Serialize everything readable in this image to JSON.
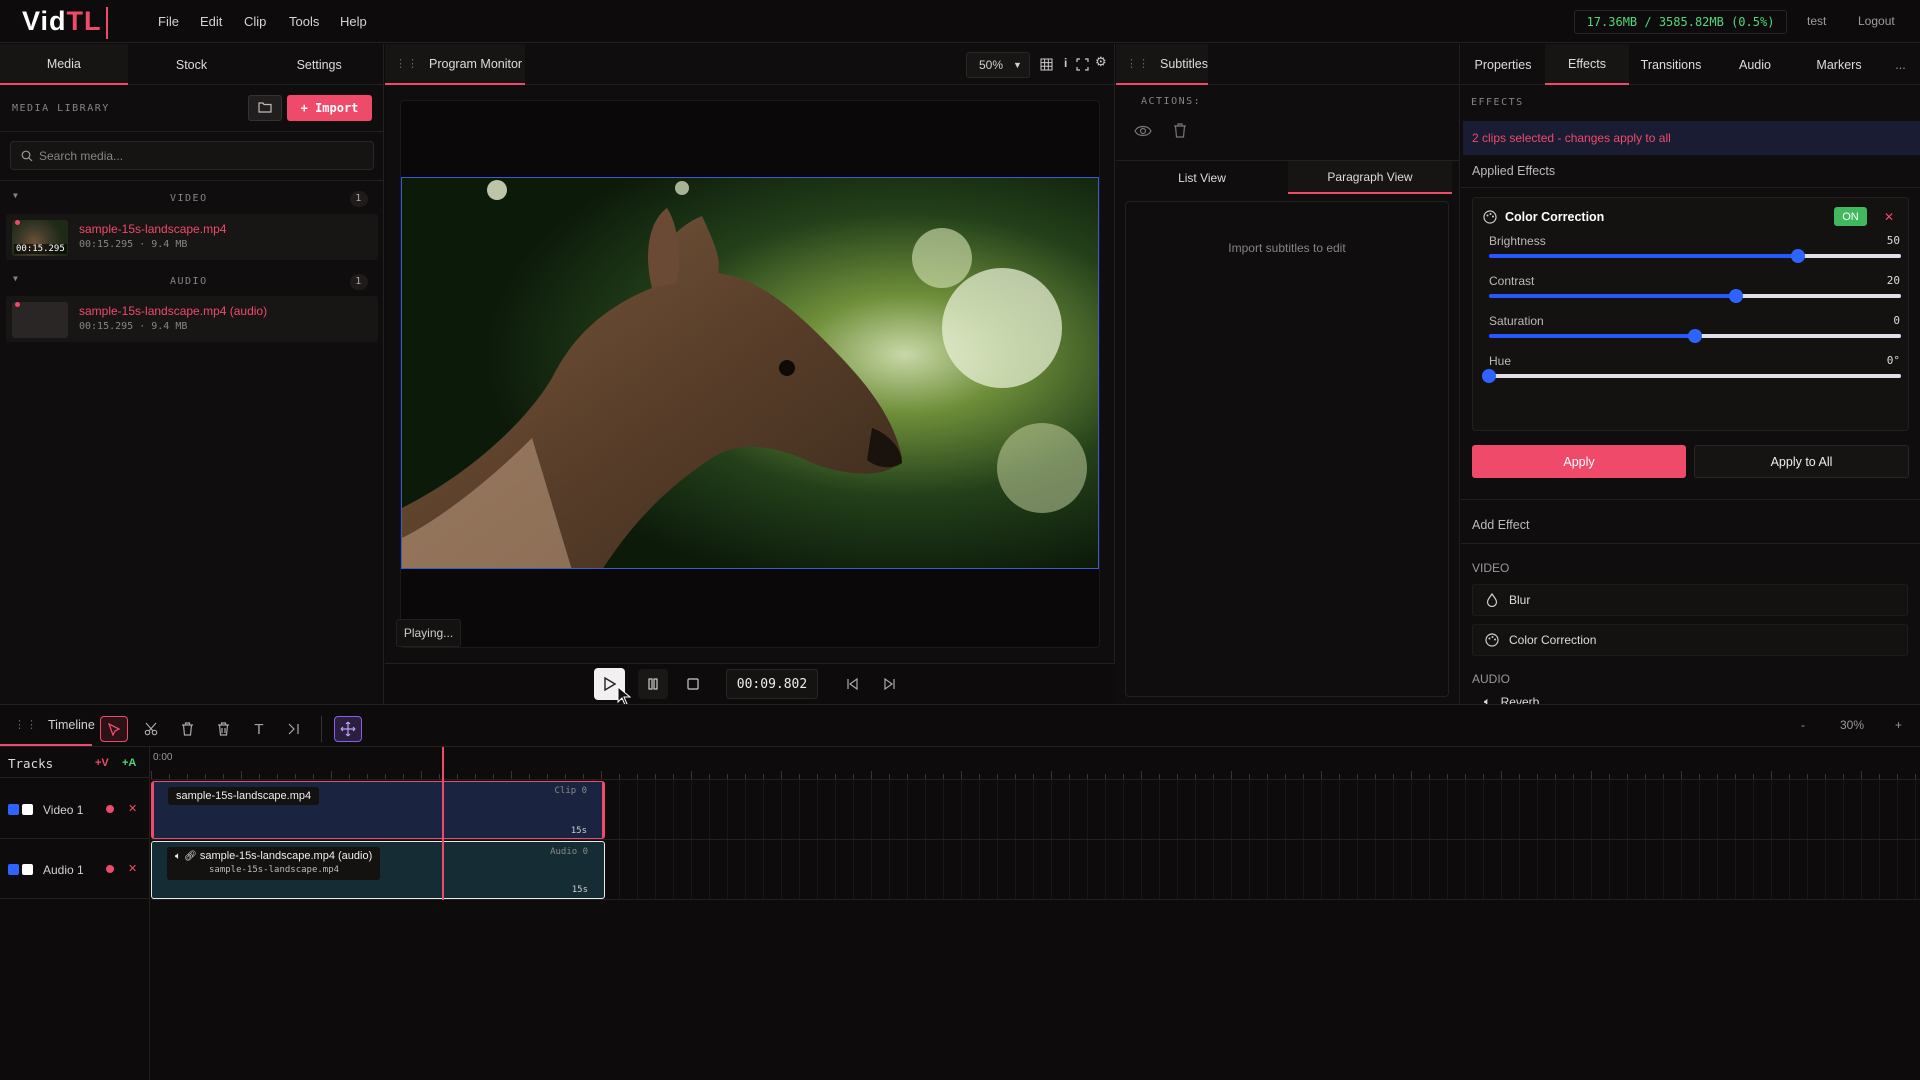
{
  "app": {
    "logo_main": "Vid",
    "logo_accent": "TL"
  },
  "menu": [
    "File",
    "Edit",
    "Clip",
    "Tools",
    "Help"
  ],
  "topbar": {
    "memory": "17.36MB / 3585.82MB (0.5%)",
    "user": "test",
    "logout": "Logout"
  },
  "left_panel": {
    "tabs": [
      "Media",
      "Stock",
      "Settings"
    ],
    "active_tab": "Media",
    "library_title": "MEDIA LIBRARY",
    "import_label": "+ Import",
    "search_placeholder": "Search media...",
    "sections": [
      {
        "title": "VIDEO",
        "count": "1",
        "items": [
          {
            "name": "sample-15s-landscape.mp4",
            "meta": "00:15.295 · 9.4 MB",
            "thumb_time": "00:15.295"
          }
        ]
      },
      {
        "title": "AUDIO",
        "count": "1",
        "items": [
          {
            "name": "sample-15s-landscape.mp4 (audio)",
            "meta": "00:15.295 · 9.4 MB"
          }
        ]
      }
    ]
  },
  "monitor": {
    "title": "Program Monitor",
    "zoom": "50%",
    "status": "Playing...",
    "timecode": "00:09.802"
  },
  "subtitles": {
    "title": "Subtitles",
    "actions_label": "ACTIONS:",
    "views": [
      "List View",
      "Paragraph View"
    ],
    "active_view": "Paragraph View",
    "empty_text": "Import subtitles to edit"
  },
  "right_panel": {
    "tabs": [
      "Properties",
      "Effects",
      "Transitions",
      "Audio",
      "Markers"
    ],
    "active_tab": "Effects",
    "more": "...",
    "effects_title": "EFFECTS",
    "notice": "2 clips selected - changes apply to all",
    "applied_title": "Applied Effects",
    "effect": {
      "name": "Color Correction",
      "toggle": "ON",
      "params": [
        {
          "label": "Brightness",
          "value": "50",
          "pos": 0.75
        },
        {
          "label": "Contrast",
          "value": "20",
          "pos": 0.6
        },
        {
          "label": "Saturation",
          "value": "0",
          "pos": 0.5
        },
        {
          "label": "Hue",
          "value": "0°",
          "pos": 0.0
        }
      ]
    },
    "apply": "Apply",
    "apply_all": "Apply to All",
    "add_effect": "Add Effect",
    "video_header": "VIDEO",
    "video_effects": [
      "Blur",
      "Color Correction"
    ],
    "audio_header": "AUDIO",
    "audio_effects": [
      "Reverb"
    ]
  },
  "timeline": {
    "title": "Timeline",
    "zoom_minus": "-",
    "zoom": "30%",
    "zoom_plus": "+",
    "ruler_start": "0:00",
    "tracks_label": "Tracks",
    "add_video": "+V",
    "add_audio": "+A",
    "tracks": [
      {
        "name": "Video 1",
        "clip_label": "sample-15s-landscape.mp4",
        "clip_id": "Clip 0",
        "duration": "15s"
      },
      {
        "name": "Audio 1",
        "clip_label": "sample-15s-landscape.mp4 (audio)",
        "clip_sub": "sample-15s-landscape.mp4",
        "clip_id": "Audio 0",
        "duration": "15s"
      }
    ]
  },
  "colors": {
    "accent": "#f04a6a",
    "blue": "#2f63ff",
    "green": "#52d87a"
  }
}
